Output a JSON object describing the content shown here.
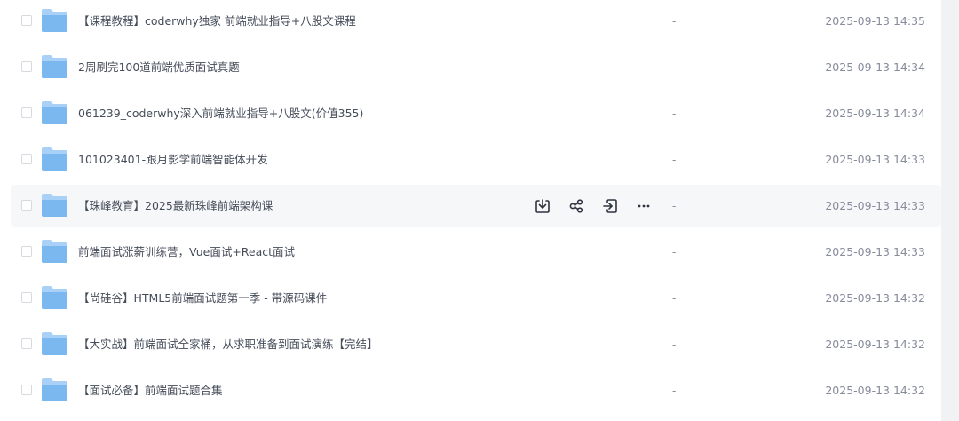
{
  "files": [
    {
      "name": "【课程教程】coderwhy独家 前端就业指导+八股文课程",
      "size": "-",
      "modified": "2025-09-13 14:35"
    },
    {
      "name": "2周刷完100道前端优质面试真题",
      "size": "-",
      "modified": "2025-09-13 14:34"
    },
    {
      "name": "061239_coderwhy深入前端就业指导+八股文(价值355)",
      "size": "-",
      "modified": "2025-09-13 14:34"
    },
    {
      "name": "101023401-跟月影学前端智能体开发",
      "size": "-",
      "modified": "2025-09-13 14:33"
    },
    {
      "name": "【珠峰教育】2025最新珠峰前端架构课",
      "size": "-",
      "modified": "2025-09-13 14:33"
    },
    {
      "name": "前端面试涨薪训练营，Vue面试+React面试",
      "size": "-",
      "modified": "2025-09-13 14:33"
    },
    {
      "name": "【尚硅谷】HTML5前端面试题第一季 - 带源码课件",
      "size": "-",
      "modified": "2025-09-13 14:32"
    },
    {
      "name": "【大实战】前端面试全家桶，从求职准备到面试演练【完结】",
      "size": "-",
      "modified": "2025-09-13 14:32"
    },
    {
      "name": "【面试必备】前端面试题合集",
      "size": "-",
      "modified": "2025-09-13 14:32"
    }
  ],
  "hovered_row_index": 4,
  "row_actions": [
    "download-icon",
    "share-icon",
    "move-icon",
    "more-icon"
  ],
  "colors": {
    "folder": "#7bb8f0",
    "hover_bg": "#f6f7f9",
    "text": "#454d5a",
    "muted": "#878c9c"
  }
}
